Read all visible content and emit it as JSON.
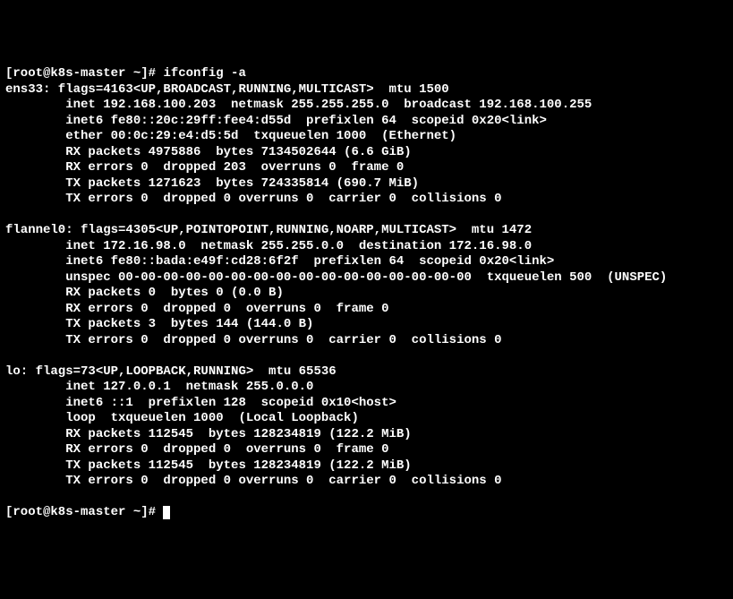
{
  "prompt": "[root@k8s-master ~]# ",
  "command": "ifconfig -a",
  "interfaces": [
    {
      "name": "ens33",
      "header": "flags=4163<UP,BROADCAST,RUNNING,MULTICAST>  mtu 1500",
      "lines": [
        "inet 192.168.100.203  netmask 255.255.255.0  broadcast 192.168.100.255",
        "inet6 fe80::20c:29ff:fee4:d55d  prefixlen 64  scopeid 0x20<link>",
        "ether 00:0c:29:e4:d5:5d  txqueuelen 1000  (Ethernet)",
        "RX packets 4975886  bytes 7134502644 (6.6 GiB)",
        "RX errors 0  dropped 203  overruns 0  frame 0",
        "TX packets 1271623  bytes 724335814 (690.7 MiB)",
        "TX errors 0  dropped 0 overruns 0  carrier 0  collisions 0"
      ]
    },
    {
      "name": "flannel0",
      "header": "flags=4305<UP,POINTOPOINT,RUNNING,NOARP,MULTICAST>  mtu 1472",
      "lines": [
        "inet 172.16.98.0  netmask 255.255.0.0  destination 172.16.98.0",
        "inet6 fe80::bada:e49f:cd28:6f2f  prefixlen 64  scopeid 0x20<link>",
        "unspec 00-00-00-00-00-00-00-00-00-00-00-00-00-00-00-00  txqueuelen 500  (UNSPEC)",
        "RX packets 0  bytes 0 (0.0 B)",
        "RX errors 0  dropped 0  overruns 0  frame 0",
        "TX packets 3  bytes 144 (144.0 B)",
        "TX errors 0  dropped 0 overruns 0  carrier 0  collisions 0"
      ]
    },
    {
      "name": "lo",
      "header": "flags=73<UP,LOOPBACK,RUNNING>  mtu 65536",
      "lines": [
        "inet 127.0.0.1  netmask 255.0.0.0",
        "inet6 ::1  prefixlen 128  scopeid 0x10<host>",
        "loop  txqueuelen 1000  (Local Loopback)",
        "RX packets 112545  bytes 128234819 (122.2 MiB)",
        "RX errors 0  dropped 0  overruns 0  frame 0",
        "TX packets 112545  bytes 128234819 (122.2 MiB)",
        "TX errors 0  dropped 0 overruns 0  carrier 0  collisions 0"
      ]
    }
  ],
  "end_prompt": "[root@k8s-master ~]# "
}
